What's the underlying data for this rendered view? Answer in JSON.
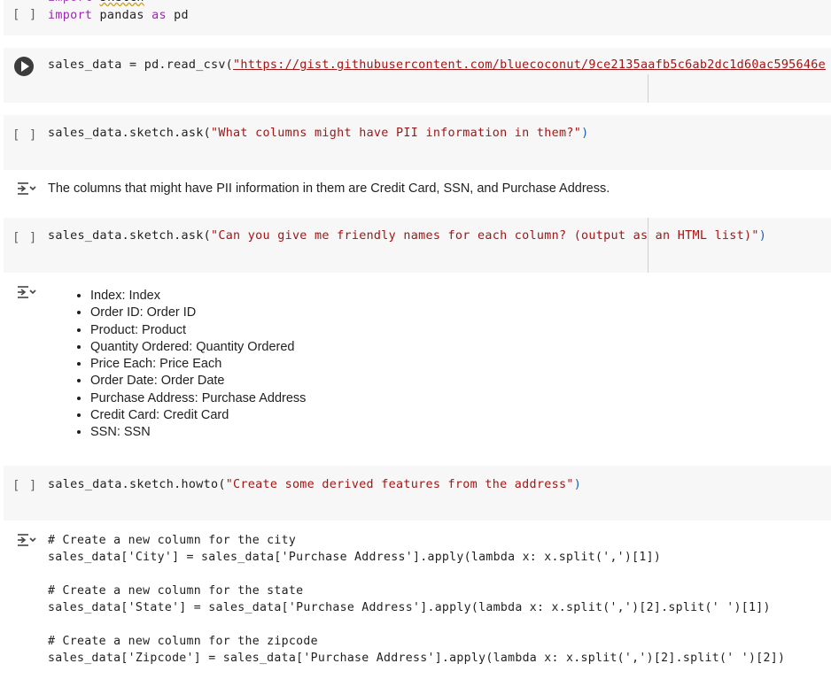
{
  "cells": {
    "c1": {
      "gutter": "[ ]",
      "line0": "import sketch",
      "line1_kw1": "import",
      "line1_mod": " pandas ",
      "line1_kw2": "as",
      "line1_alias": " pd"
    },
    "c2": {
      "prefix": "sales_data = pd.read_csv(",
      "url": "\"https://gist.githubusercontent.com/bluecoconut/9ce2135aafb5c6ab2dc1d60ac595646e"
    },
    "c3": {
      "gutter": "[ ]",
      "prefix": "sales_data.sketch.ask(",
      "arg": "\"What columns might have PII information in them?\"",
      "close": ")"
    },
    "o3": {
      "text": "The columns that might have PII information in them are Credit Card, SSN, and Purchase Address."
    },
    "c4": {
      "gutter": "[ ]",
      "prefix": "sales_data.sketch.ask(",
      "arg": "\"Can you give me friendly names for each column? (output as an HTML list)\"",
      "close": ")"
    },
    "o4": {
      "items": [
        "Index: Index",
        "Order ID: Order ID",
        "Product: Product",
        "Quantity Ordered: Quantity Ordered",
        "Price Each: Price Each",
        "Order Date: Order Date",
        "Purchase Address: Purchase Address",
        "Credit Card: Credit Card",
        "SSN: SSN"
      ]
    },
    "c5": {
      "gutter": "[ ]",
      "prefix": "sales_data.sketch.howto(",
      "arg": "\"Create some derived features from the address\"",
      "close": ")"
    },
    "o5": {
      "lines": [
        "# Create a new column for the city",
        "sales_data['City'] = sales_data['Purchase Address'].apply(lambda x: x.split(',')[1])",
        "",
        "# Create a new column for the state",
        "sales_data['State'] = sales_data['Purchase Address'].apply(lambda x: x.split(',')[2].split(' ')[1])",
        "",
        "# Create a new column for the zipcode",
        "sales_data['Zipcode'] = sales_data['Purchase Address'].apply(lambda x: x.split(',')[2].split(' ')[2])"
      ]
    }
  },
  "icons": {
    "run": "play-circle-icon",
    "output": "output-toggle-icon"
  }
}
